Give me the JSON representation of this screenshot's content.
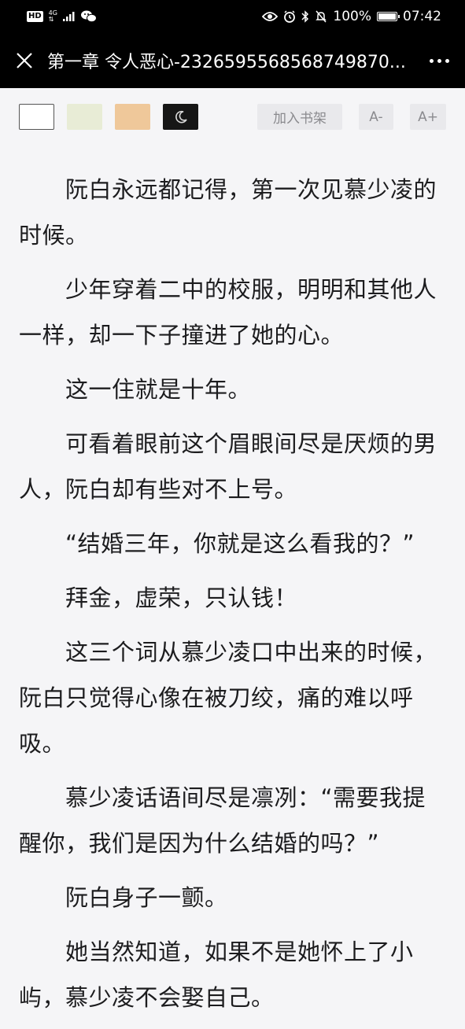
{
  "status_bar": {
    "hd": "HD",
    "network": "4G",
    "battery": "100%",
    "time": "07:42"
  },
  "header": {
    "title": "第一章 令人恶心-2326595568568749870..."
  },
  "toolbar": {
    "themes": [
      "white",
      "green",
      "tan",
      "night"
    ],
    "add_to_shelf": "加入书架",
    "font_smaller": "A-",
    "font_larger": "A+"
  },
  "content": {
    "paragraphs": [
      "阮白永远都记得，第一次见慕少凌的时候。",
      "少年穿着二中的校服，明明和其他人一样，却一下子撞进了她的心。",
      "这一住就是十年。",
      "可看着眼前这个眉眼间尽是厌烦的男人，阮白却有些对不上号。",
      "“结婚三年，你就是这么看我的？”",
      "拜金，虚荣，只认钱！",
      "这三个词从慕少凌口中出来的时候，阮白只觉得心像在被刀绞，痛的难以呼吸。",
      "慕少凌话语间尽是凛冽：“需要我提醒你，我们是因为什么结婚的吗？”",
      "阮白身子一颤。",
      "她当然知道，如果不是她怀上了小屿，慕少凌不会娶自己。"
    ]
  }
}
